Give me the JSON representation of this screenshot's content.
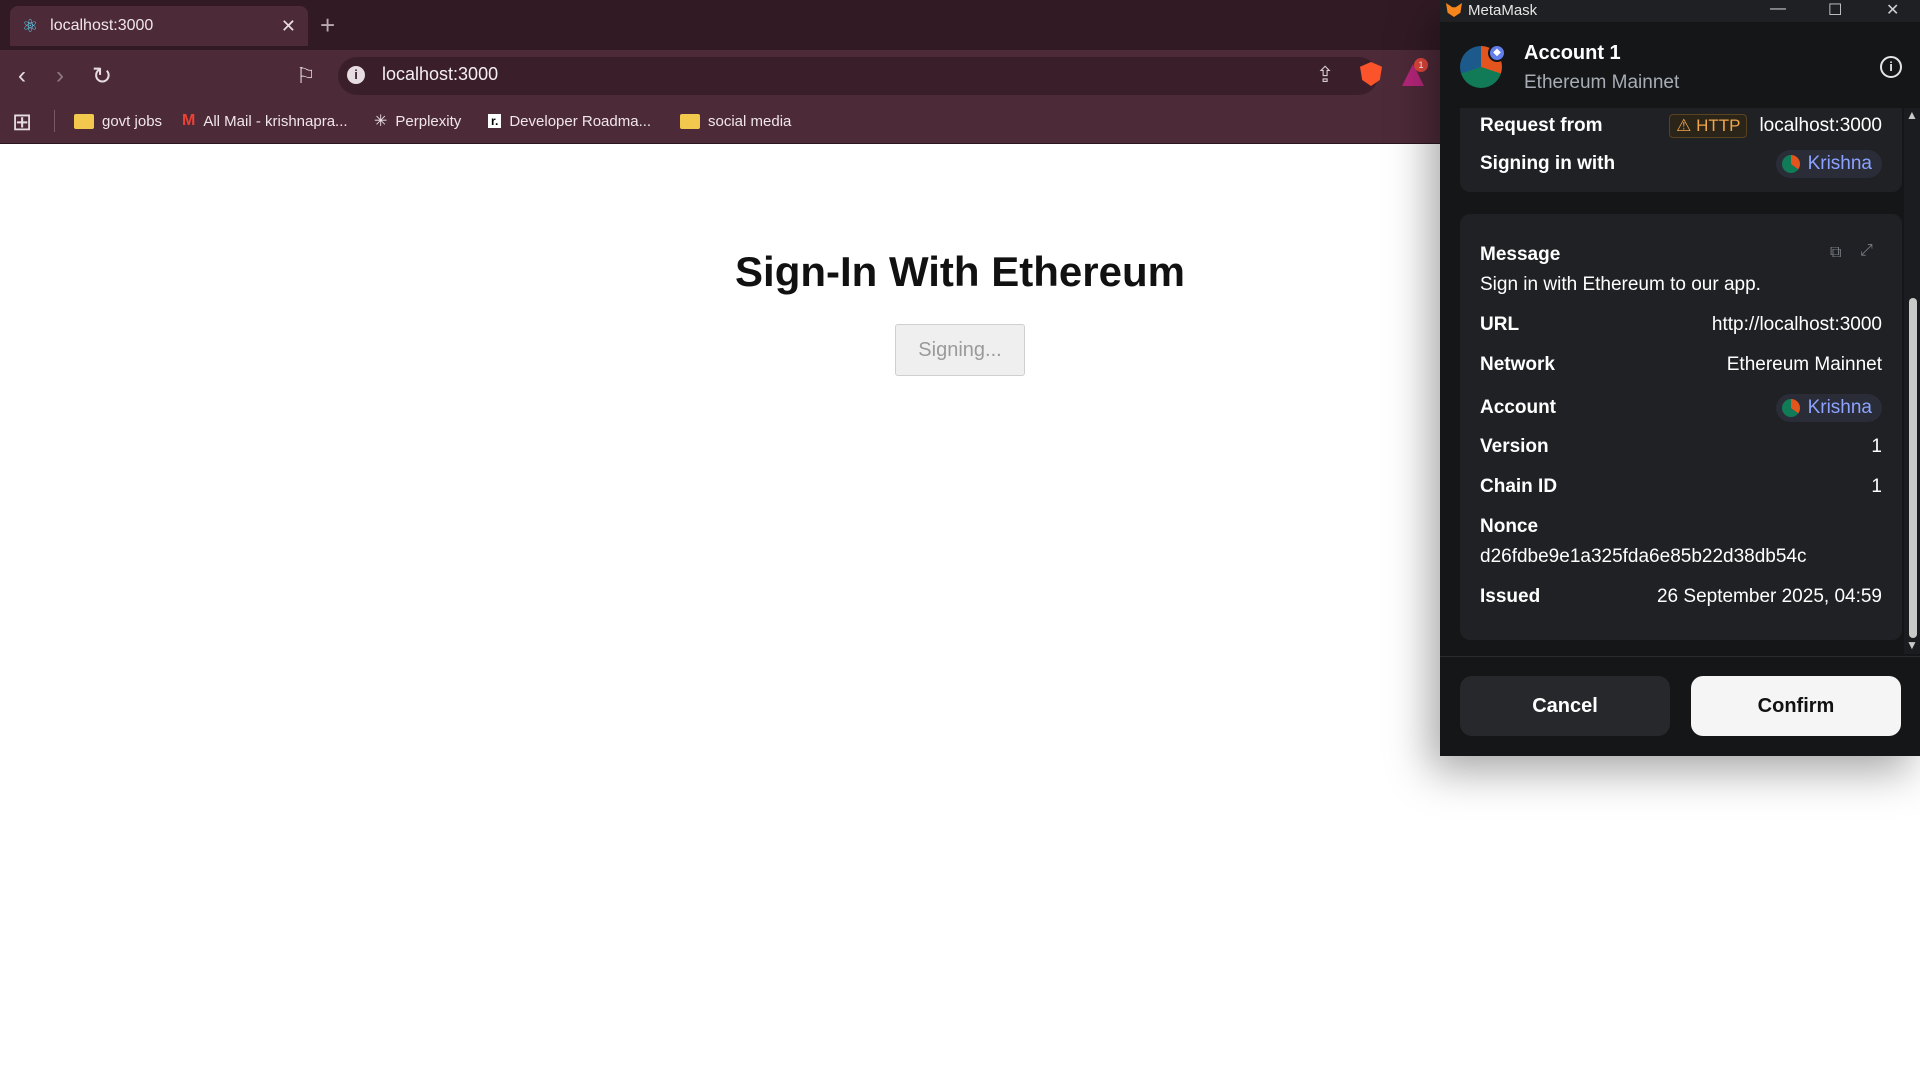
{
  "browser": {
    "tab_title": "localhost:3000",
    "url": "localhost:3000",
    "bookmarks": [
      {
        "label": "govt jobs"
      },
      {
        "label": "All Mail - krishnapra..."
      },
      {
        "label": "Perplexity"
      },
      {
        "label": "Developer Roadma..."
      },
      {
        "label": "social media"
      }
    ],
    "rewards_badge": "1"
  },
  "page": {
    "title": "Sign-In With Ethereum",
    "button_label": "Signing..."
  },
  "metamask": {
    "window_title": "MetaMask",
    "account_name": "Account 1",
    "network": "Ethereum Mainnet",
    "request_from_label": "Request from",
    "http_badge": "HTTP",
    "request_origin": "localhost:3000",
    "signing_with_label": "Signing in with",
    "signing_with_value": "Krishna",
    "message_label": "Message",
    "message_text": "Sign in with Ethereum to our app.",
    "fields": [
      {
        "label": "URL",
        "value": "http://localhost:3000"
      },
      {
        "label": "Network",
        "value": "Ethereum Mainnet"
      },
      {
        "label": "Account",
        "value": "Krishna"
      },
      {
        "label": "Version",
        "value": "1"
      },
      {
        "label": "Chain ID",
        "value": "1"
      }
    ],
    "nonce_label": "Nonce",
    "nonce_value": "d26fdbe9e1a325fda6e85b22d38db54c",
    "issued_label": "Issued",
    "issued_value": "26 September 2025, 04:59",
    "cancel_label": "Cancel",
    "confirm_label": "Confirm"
  },
  "colors": {
    "browser_frame": "#4d2a38",
    "metamask_bg": "#141618",
    "link_pill": "#8ba2ff",
    "http_warning": "#f0a54a"
  }
}
